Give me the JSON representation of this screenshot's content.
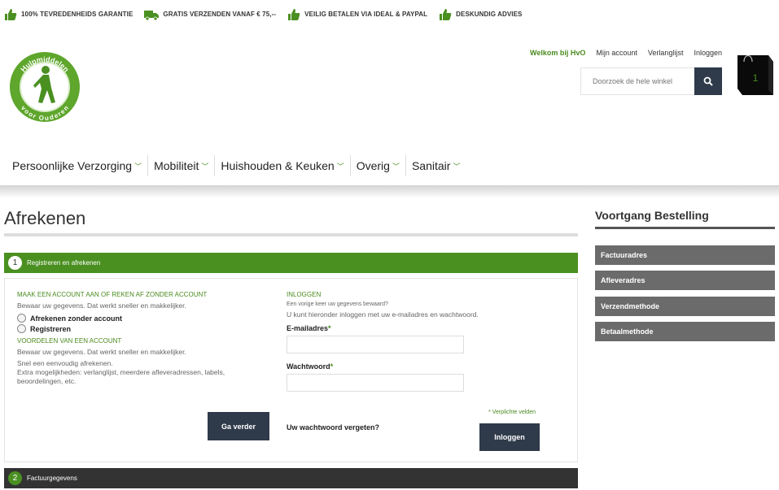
{
  "usp": [
    {
      "icon": "thumbs-up-icon",
      "text": "100% tevredenheids garantie"
    },
    {
      "icon": "truck-icon",
      "text": "Gratis verzenden vanaf € 75,--"
    },
    {
      "icon": "thumbs-up-icon",
      "text": "Veilig betalen via iDEAL & Paypal"
    },
    {
      "icon": "thumbs-up-icon",
      "text": "Deskundig advies"
    }
  ],
  "logo": {
    "top_text": "Hulpmiddelen",
    "bottom_text": "voor Ouderen"
  },
  "toplinks": {
    "welcome": "Welkom bij HvO",
    "account": "Mijn account",
    "wishlist": "Verlanglijst",
    "login": "Inloggen"
  },
  "search": {
    "placeholder": "Doorzoek de hele winkel"
  },
  "cart": {
    "count": "1"
  },
  "nav": [
    {
      "label": "Persoonlijke Verzorging"
    },
    {
      "label": "Mobiliteit"
    },
    {
      "label": "Huishouden & Keuken"
    },
    {
      "label": "Overig"
    },
    {
      "label": "Sanitair"
    }
  ],
  "page_title": "Afrekenen",
  "step1": {
    "number": "1",
    "label": "Registreren en afrekenen"
  },
  "step2": {
    "number": "2",
    "label": "Factuurgegevens"
  },
  "left": {
    "heading": "Maak een account aan of reken af zonder account",
    "intro": "Bewaar uw gegevens. Dat werkt sneller en makkelijker.",
    "option_guest": "Afrekenen zonder account",
    "option_register": "Registreren",
    "benefits_heading": "Voordelen van een account",
    "benefits_intro": "Bewaar uw gegevens. Dat werkt sneller en makkelijker.",
    "benefit_1": "Snel een eenvoudig afrekenen.",
    "benefit_2": "Extra mogelijkheden: verlanglijst, meerdere afleveradressen, labels, beoordelingen, etc.",
    "continue_button": "Ga verder"
  },
  "right": {
    "heading": "Inloggen",
    "question": "Een vorige keer uw gegevens bewaard?",
    "intro": "U kunt hieronder inloggen met uw e-mailadres en wachtwoord.",
    "email_label": "E-mailadres",
    "password_label": "Wachtwoord",
    "required_note": "* Verplichte velden",
    "forgot": "Uw wachtwoord vergeten?",
    "login_button": "Inloggen"
  },
  "sidebar": {
    "title": "Voortgang Bestelling",
    "items": [
      {
        "label": "Factuuradres"
      },
      {
        "label": "Afleveradres"
      },
      {
        "label": "Verzendmethode"
      },
      {
        "label": "Betaalmethode"
      }
    ]
  },
  "colors": {
    "brand_green": "#4a9021",
    "dark": "#2f3a4a",
    "sidebar_item": "#6b6b6b"
  }
}
